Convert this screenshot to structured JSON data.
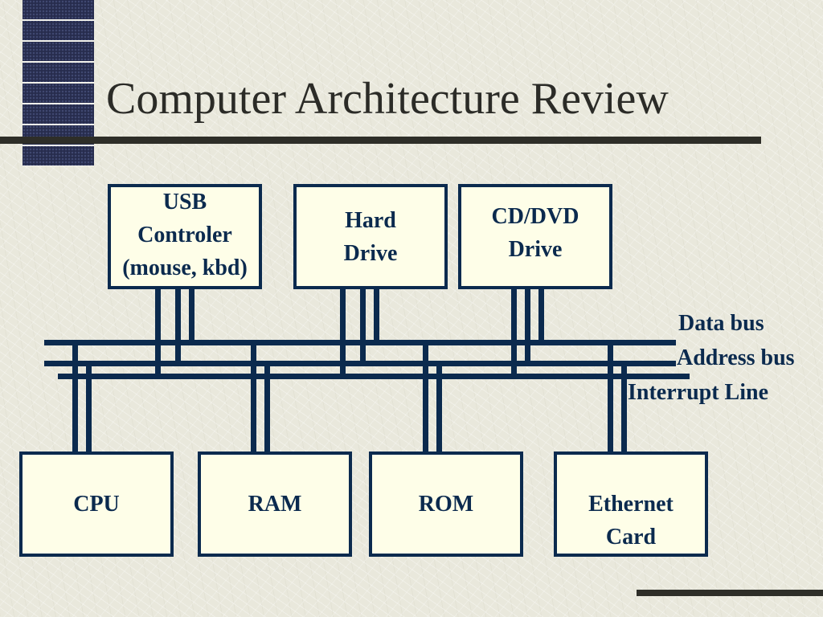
{
  "slide": {
    "title": "Computer Architecture Review",
    "colors": {
      "background": "#e9e8dc",
      "accent_navy": "#0b2a4e",
      "box_fill": "#fefee8",
      "title_text": "#2b2b27",
      "rule": "#2e2e28",
      "side_bar": "#272c4d"
    }
  },
  "diagram": {
    "top_components": [
      {
        "id": "usb",
        "label": "USB\nControler\n(mouse, kbd)"
      },
      {
        "id": "hard-drive",
        "label": "Hard\nDrive"
      },
      {
        "id": "cd-dvd",
        "label": "CD/DVD\nDrive"
      }
    ],
    "bottom_components": [
      {
        "id": "cpu",
        "label": "CPU"
      },
      {
        "id": "ram",
        "label": "RAM"
      },
      {
        "id": "rom",
        "label": "ROM"
      },
      {
        "id": "ethernet",
        "label": "Ethernet\nCard"
      }
    ],
    "buses": [
      {
        "id": "data-bus",
        "label": "Data bus"
      },
      {
        "id": "address-bus",
        "label": "Address bus"
      },
      {
        "id": "interrupt-line",
        "label": "Interrupt Line"
      }
    ],
    "connections": [
      {
        "from": "usb",
        "to": [
          "data-bus",
          "address-bus",
          "interrupt-line"
        ]
      },
      {
        "from": "hard-drive",
        "to": [
          "data-bus",
          "address-bus",
          "interrupt-line"
        ]
      },
      {
        "from": "cd-dvd",
        "to": [
          "data-bus",
          "address-bus",
          "interrupt-line"
        ]
      },
      {
        "from": "cpu",
        "to": [
          "data-bus",
          "address-bus"
        ]
      },
      {
        "from": "ram",
        "to": [
          "data-bus",
          "address-bus"
        ]
      },
      {
        "from": "rom",
        "to": [
          "data-bus",
          "address-bus"
        ]
      },
      {
        "from": "ethernet",
        "to": [
          "data-bus",
          "address-bus"
        ]
      }
    ]
  }
}
